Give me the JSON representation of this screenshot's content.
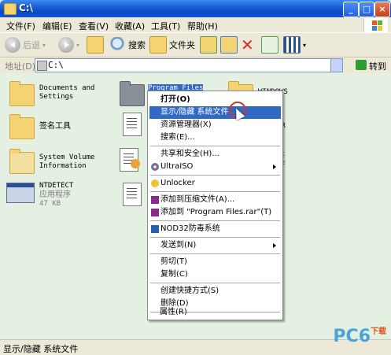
{
  "window": {
    "title": "C:\\"
  },
  "menubar": {
    "items": [
      "文件(F)",
      "编辑(E)",
      "查看(V)",
      "收藏(A)",
      "工具(T)",
      "帮助(H)"
    ]
  },
  "toolbar": {
    "back_label": "后退",
    "search_label": "搜索",
    "folders_label": "文件夹"
  },
  "address": {
    "label": "地址(D)",
    "value": "C:\\",
    "go_label": "转到"
  },
  "files": [
    {
      "name": "Documents and\nSettings",
      "type": "folder"
    },
    {
      "name": "Program Files",
      "type": "folder",
      "selected": true
    },
    {
      "name": "WINDOWS",
      "type": "folder"
    },
    {
      "name": "签名工具",
      "type": "folder"
    },
    {
      "name": "ER",
      "type": "document"
    },
    {
      "name": "System Volume\nInformation",
      "type": "folder"
    },
    {
      "name": "nt\nle",
      "type": "document"
    },
    {
      "name": "NTDETECT",
      "sub1": "应用程序",
      "sub2": "47 KB",
      "type": "app"
    },
    {
      "name": "",
      "type": "document"
    }
  ],
  "context_menu": {
    "items": [
      {
        "label": "打开(O)",
        "bold": true
      },
      {
        "label": "显示/隐藏 系统文件",
        "highlighted": true
      },
      {
        "label": "资源管理器(X)"
      },
      {
        "label": "搜索(E)..."
      },
      {
        "separator": true
      },
      {
        "label": "共享和安全(H)..."
      },
      {
        "label": "UltraISO",
        "submenu": true
      },
      {
        "separator": true
      },
      {
        "label": "Unlocker"
      },
      {
        "separator": true
      },
      {
        "label": "添加到压缩文件(A)..."
      },
      {
        "label": "添加到 \"Program Files.rar\"(T)"
      },
      {
        "separator": true
      },
      {
        "label": "NOD32防毒系统"
      },
      {
        "separator": true
      },
      {
        "label": "发送到(N)",
        "submenu": true
      },
      {
        "separator": true
      },
      {
        "label": "剪切(T)"
      },
      {
        "label": "复制(C)"
      },
      {
        "separator": true
      },
      {
        "label": "创建快捷方式(S)"
      },
      {
        "label": "删除(D)"
      },
      {
        "separator": true
      },
      {
        "label": "属性(R)"
      }
    ]
  },
  "status": {
    "text": "显示/隐藏 系统文件"
  },
  "watermark": {
    "brand": "PC6",
    "sub": "下载"
  }
}
